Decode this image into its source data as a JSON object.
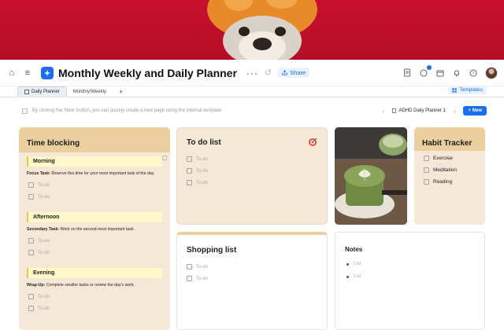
{
  "header": {
    "title": "Monthly Weekly and Daily Planner",
    "share_label": "Share",
    "more_label": "···"
  },
  "tabs": [
    {
      "label": "Daily Planner",
      "active": true
    },
    {
      "label": "Monthly/Weekly",
      "active": false
    }
  ],
  "templates_label": "Templates",
  "hint_text": "By clicking the 'New' button, you can quickly create a new page using the internal template",
  "nav": {
    "current": "ADHD Daily Planner 1",
    "new_label": "New"
  },
  "time_blocking": {
    "title": "Time blocking",
    "sections": [
      {
        "name": "Morning",
        "task_label": "Focus Task:",
        "task_text": " Reserve this time for your most important task of the day.",
        "todos": [
          "To-do",
          "To-do"
        ]
      },
      {
        "name": "Afternoon",
        "task_label": "Secondary Task:",
        "task_text": " Work on the second most important task.",
        "todos": [
          "To-do",
          "To-do"
        ]
      },
      {
        "name": "Evening",
        "task_label": "Wrap-Up:",
        "task_text": " Complete smaller tasks or review the day's work.",
        "todos": [
          "To-do",
          "To-do"
        ]
      }
    ]
  },
  "todo_list": {
    "title": "To do list",
    "items": [
      "To-do",
      "To-do",
      "To-do"
    ]
  },
  "shopping_list": {
    "title": "Shopping list",
    "items": [
      "To-do",
      "To-do"
    ]
  },
  "habit_tracker": {
    "title": "Habit Tracker",
    "items": [
      "Exercise",
      "Meditation",
      "Reading"
    ]
  },
  "notes": {
    "title": "Notes",
    "items": [
      "List",
      "List"
    ]
  },
  "colors": {
    "accent": "#1a6ef5",
    "cover": "#c8102e",
    "card_tan": "#f6e8d6",
    "card_head": "#ebcf9f",
    "section_highlight": "#fff9c9"
  }
}
